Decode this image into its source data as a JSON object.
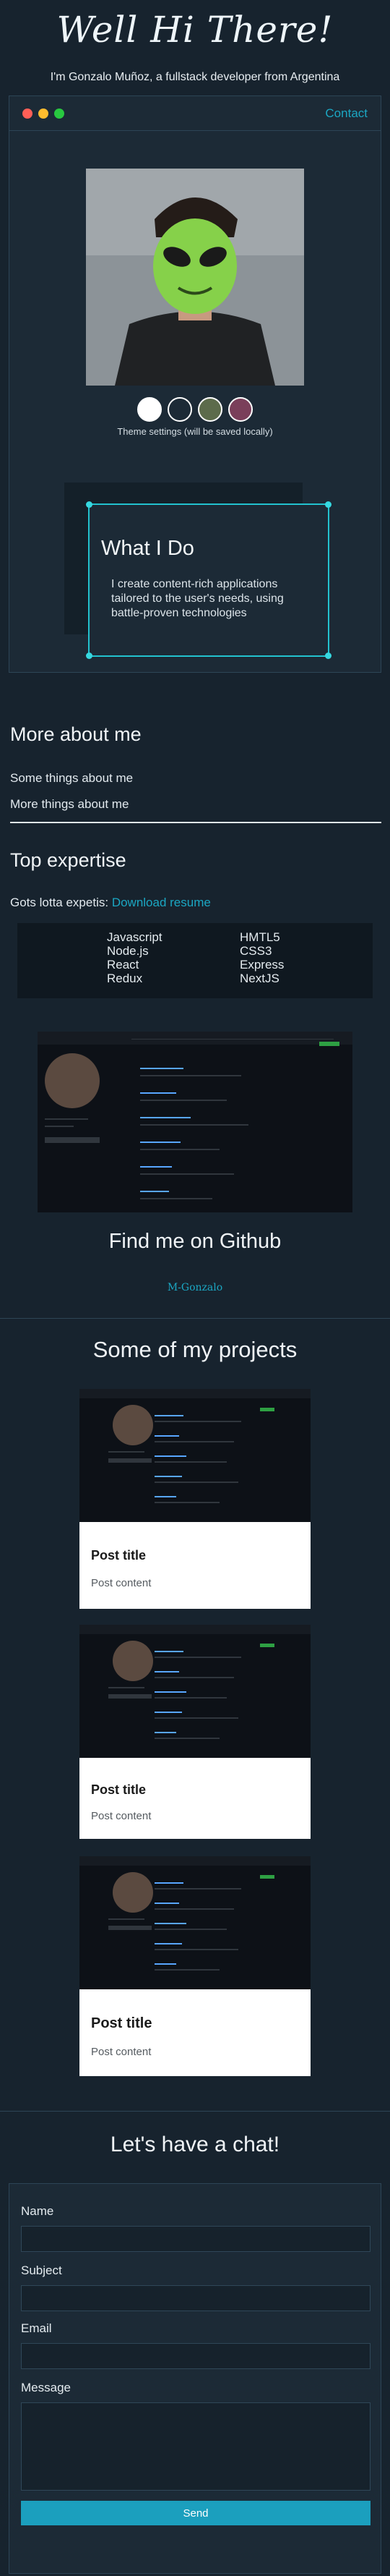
{
  "header": {
    "title": "Well Hi There!",
    "subtitle": "I'm Gonzalo Muñoz, a fullstack developer from Argentina"
  },
  "window": {
    "contact_label": "Contact",
    "theme_note": "Theme settings (will be saved locally)",
    "swatch_colors": [
      "#ffffff",
      "#1c2a36",
      "#5c6b4b",
      "#7a3f5a"
    ],
    "card_title": "What I Do",
    "card_body": "I create content-rich applications tailored to the user's needs, using battle-proven technologies"
  },
  "about": {
    "title": "More about me",
    "lines": [
      "Some things about me",
      "More things about me"
    ]
  },
  "expertise": {
    "title": "Top expertise",
    "intro": "Gots lotta expetis:",
    "link": "Download resume",
    "skills_left": [
      "Javascript",
      "Node.js",
      "React",
      "Redux"
    ],
    "skills_right": [
      "HMTL5",
      "CSS3",
      "Express",
      "NextJS"
    ]
  },
  "github": {
    "title": "Find me on Github",
    "link": "M-Gonzalo"
  },
  "projects": {
    "title": "Some of my projects",
    "posts": [
      {
        "title": "Post title",
        "content": "Post content"
      },
      {
        "title": "Post title",
        "content": "Post content"
      },
      {
        "title": "Post title",
        "content": "Post content"
      }
    ]
  },
  "contact": {
    "title": "Let's have a chat!",
    "name_label": "Name",
    "subject_label": "Subject",
    "email_label": "Email",
    "message_label": "Message",
    "send_label": "Send"
  },
  "colors": {
    "accent": "#1ba7c3",
    "background": "#17232e",
    "card_border": "#22c2cf"
  }
}
